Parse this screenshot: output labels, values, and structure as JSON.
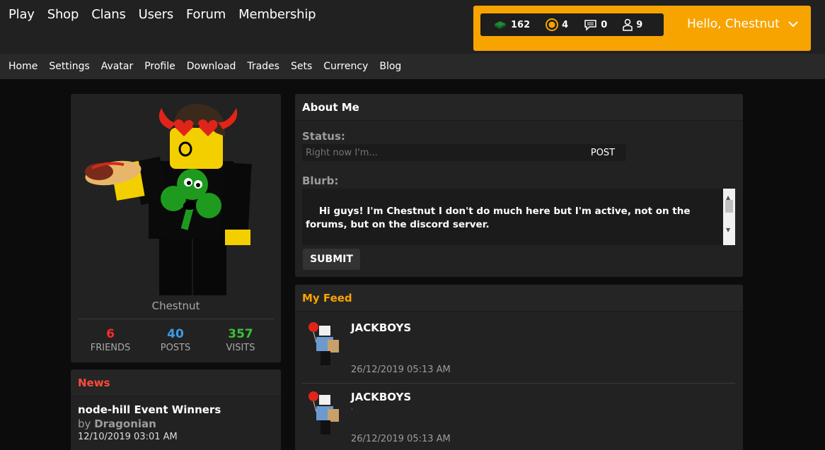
{
  "main_nav": [
    "Play",
    "Shop",
    "Clans",
    "Users",
    "Forum",
    "Membership"
  ],
  "user_stats": {
    "bucks": "162",
    "bits": "4",
    "messages": "0",
    "friend_requests": "9"
  },
  "greeting": "Hello, Chestnut",
  "sub_nav": [
    "Home",
    "Settings",
    "Avatar",
    "Profile",
    "Download",
    "Trades",
    "Sets",
    "Currency",
    "Blog"
  ],
  "profile": {
    "username": "Chestnut",
    "stats": [
      {
        "value": "6",
        "label": "FRIENDS",
        "color": "#ff2a2a"
      },
      {
        "value": "40",
        "label": "POSTS",
        "color": "#3b9bea"
      },
      {
        "value": "357",
        "label": "VISITS",
        "color": "#38c238"
      }
    ]
  },
  "news": {
    "title": "News",
    "item_title": "node-hill Event Winners",
    "by_prefix": "by",
    "author": "Dragonian",
    "date": "12/10/2019 03:01 AM"
  },
  "about": {
    "title": "About Me",
    "status_label": "Status:",
    "status_placeholder": "Right now I'm...",
    "post_label": "POST",
    "blurb_label": "Blurb:",
    "blurb_text": "Hi guys! I'm Chestnut I don't do much here but I'm active, not on the forums, but on the discord server.\n\nMade my friends more, say, exclusive.",
    "submit_label": "SUBMIT"
  },
  "feed": {
    "title": "My Feed",
    "items": [
      {
        "user": "JACKBOYS",
        "message": "",
        "date": "26/12/2019 05:13 AM"
      },
      {
        "user": "JACKBOYS",
        "message": ".",
        "date": "26/12/2019 05:13 AM"
      }
    ]
  },
  "colors": {
    "accent_orange": "#f7a400",
    "news_red": "#ff4a3a"
  }
}
